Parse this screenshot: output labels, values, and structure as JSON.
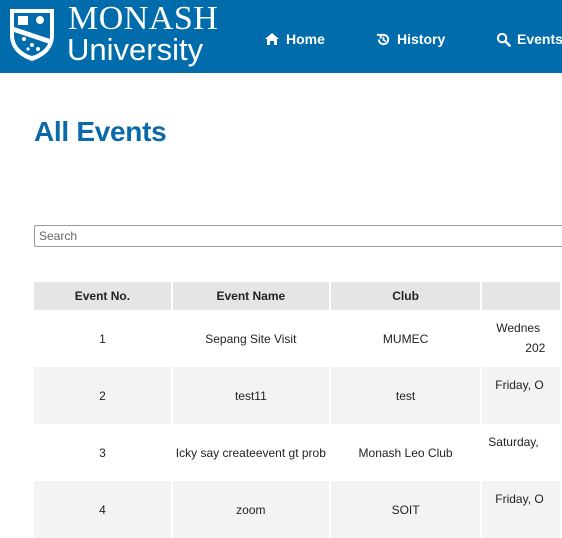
{
  "brand": {
    "line1": "MONASH",
    "line2": "University"
  },
  "nav": [
    {
      "label": "Home",
      "icon": "home-icon"
    },
    {
      "label": "History",
      "icon": "history-icon"
    },
    {
      "label": "Events",
      "icon": "search-icon"
    }
  ],
  "page": {
    "title": "All Events"
  },
  "search": {
    "placeholder": "Search"
  },
  "table": {
    "headers": [
      "Event No.",
      "Event Name",
      "Club",
      ""
    ],
    "rows": [
      {
        "no": "1",
        "name": "Sepang Site Visit",
        "club": "MUMEC",
        "date_line1": "Wednes",
        "date_line2": "202"
      },
      {
        "no": "2",
        "name": "test11",
        "club": "test",
        "date_line1": "Friday, O",
        "date_line2": ""
      },
      {
        "no": "3",
        "name": "Icky say createevent gt prob",
        "club": "Monash Leo Club",
        "date_line1": "Saturday,",
        "date_line2": ""
      },
      {
        "no": "4",
        "name": "zoom",
        "club": "SOIT",
        "date_line1": "Friday, O",
        "date_line2": ""
      }
    ]
  },
  "colors": {
    "header_bg": "#006cab",
    "title": "#0a6aa7"
  }
}
